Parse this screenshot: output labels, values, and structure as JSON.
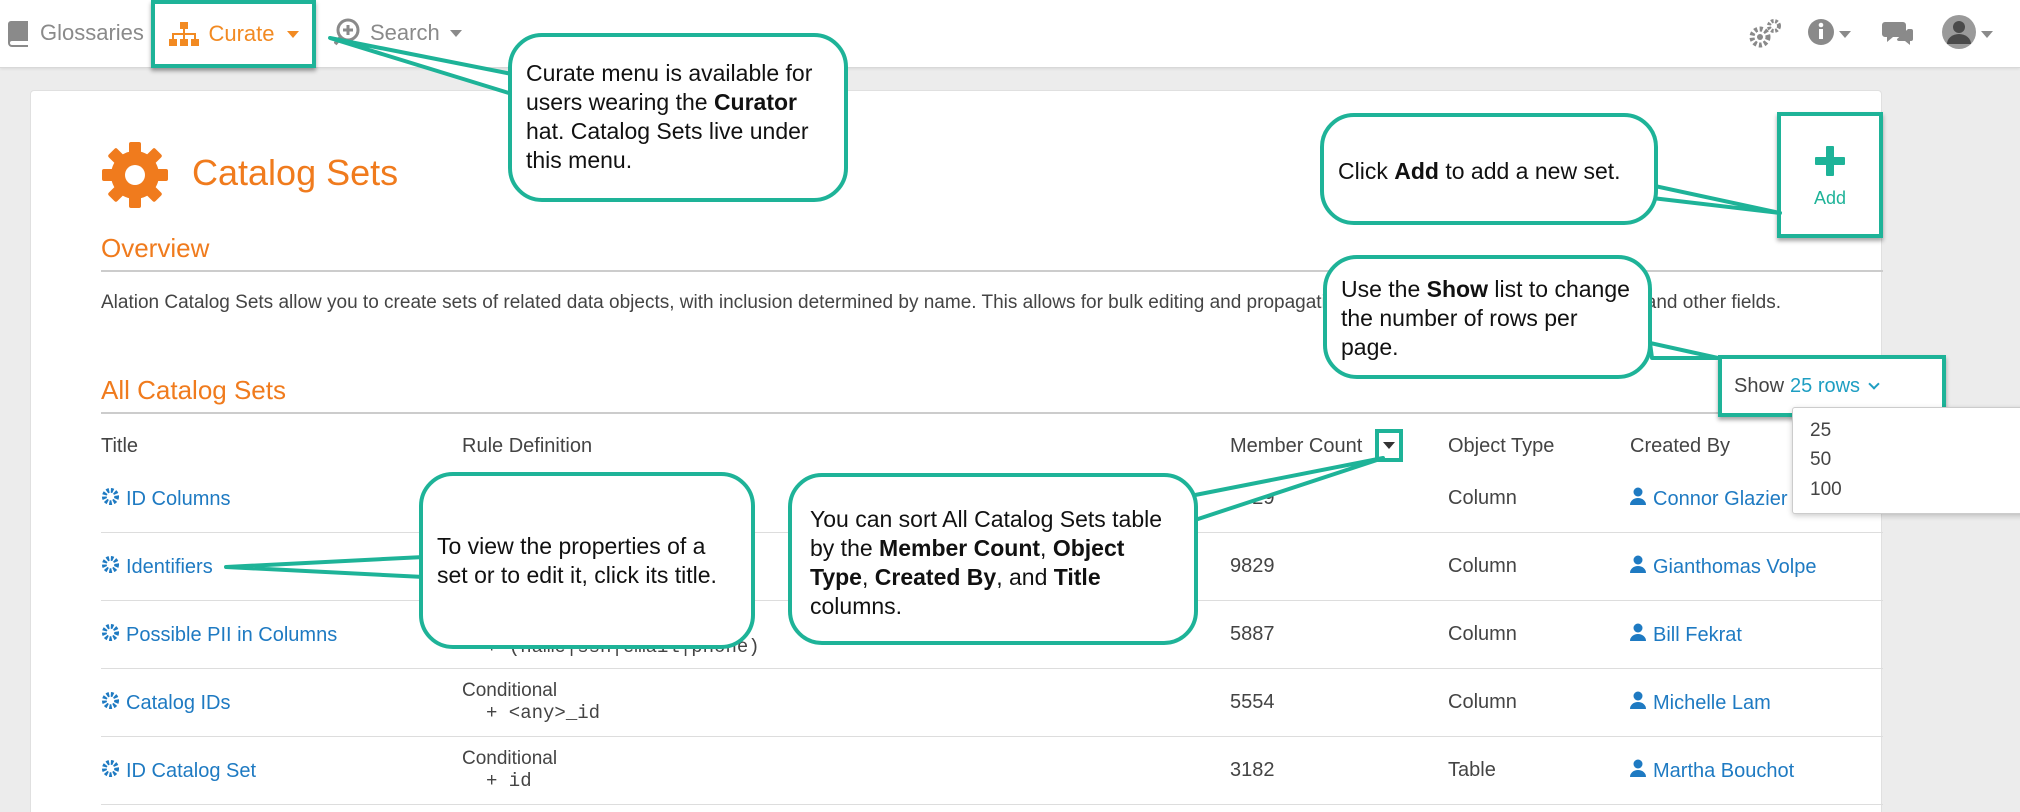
{
  "nav": {
    "glossaries": "Glossaries",
    "curate": "Curate",
    "search": "Search"
  },
  "page": {
    "title": "Catalog Sets",
    "overview_title": "Overview",
    "overview_text": "Alation Catalog Sets allow you to create sets of related data objects, with inclusion determined by name. This allows for bulk editing and propagation of shared descriptions, flags, tags, and other fields.",
    "all_title": "All Catalog Sets",
    "add_label": "Add",
    "show_label": "Show",
    "show_value": "25 rows",
    "show_options": [
      "25",
      "50",
      "100"
    ]
  },
  "table": {
    "headers": {
      "title": "Title",
      "rule": "Rule Definition",
      "count": "Member Count",
      "type": "Object Type",
      "created": "Created By"
    },
    "rows": [
      {
        "title": "ID Columns",
        "rule_kind": "",
        "rule_expr": "",
        "count": "9829",
        "type": "Column",
        "created_by": "Connor Glazier"
      },
      {
        "title": "Identifiers",
        "rule_kind": "",
        "rule_expr": "",
        "count": "9829",
        "type": "Column",
        "created_by": "Gianthomas Volpe"
      },
      {
        "title": "Possible PII in Columns",
        "rule_kind": "",
        "rule_expr": "+ (name|ssn|email|phone)",
        "count": "5887",
        "type": "Column",
        "created_by": "Bill Fekrat"
      },
      {
        "title": "Catalog IDs",
        "rule_kind": "Conditional",
        "rule_expr": "+ <any>_id",
        "count": "5554",
        "type": "Column",
        "created_by": "Michelle Lam"
      },
      {
        "title": "ID Catalog Set",
        "rule_kind": "Conditional",
        "rule_expr": "+ id",
        "count": "3182",
        "type": "Table",
        "created_by": "Martha Bouchot"
      }
    ]
  },
  "callouts": {
    "curate": [
      "Curate menu is available for users wearing the ",
      "Curator",
      " hat. Catalog Sets live under this menu."
    ],
    "add": [
      "Click ",
      "Add",
      " to add a new set."
    ],
    "show": [
      "Use the ",
      "Show",
      " list to change the number of rows per page."
    ],
    "title": "To view the properties of a set or to edit it, click its title.",
    "sort": [
      "You can sort All Catalog Sets table by the ",
      "Member Count",
      ", ",
      "Object Type",
      ", ",
      "Created By",
      ", and ",
      "Title",
      " columns."
    ]
  },
  "colors": {
    "accent_orange": "#f07b1d",
    "callout_teal": "#1eb398",
    "link_blue": "#1e7ac2"
  }
}
